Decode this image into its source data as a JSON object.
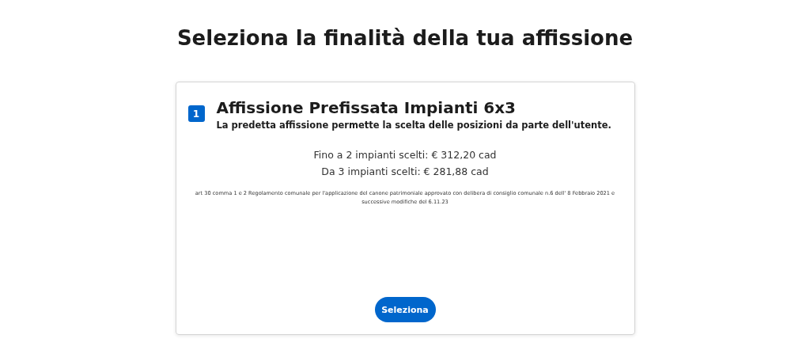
{
  "page_title": "Seleziona la finalità della tua affissione",
  "cards": [
    {
      "number": "1",
      "title": "Affissione Prefissata Impianti 6x3",
      "subtitle": "La predetta affissione permette la scelta delle posizioni da parte dell'utente.",
      "prices": [
        "Fino a 2 impianti scelti: € 312,20 cad",
        "Da 3 impianti scelti: € 281,88 cad"
      ],
      "note": "art 30 comma 1 e 2 Regolamento comunale per l'applicazione del canone patrimoniale approvato con delibera di consiglio comunale n.6 dell' 8 Febbraio 2021 e successive modifiche del 6.11.23",
      "button": "Seleziona"
    }
  ]
}
